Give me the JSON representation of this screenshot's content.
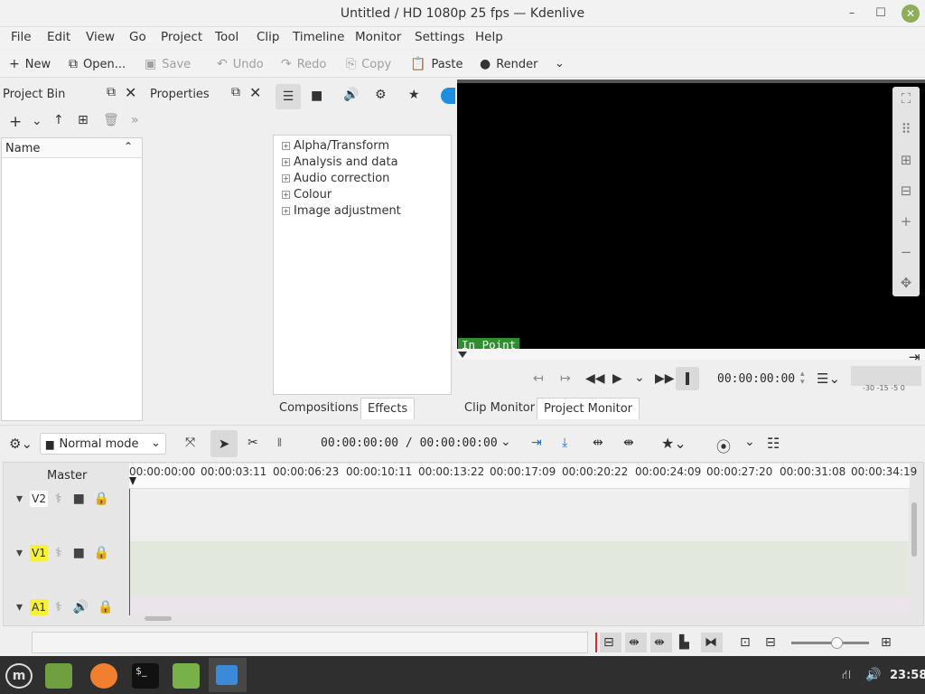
{
  "window": {
    "title": "Untitled / HD 1080p 25 fps — Kdenlive"
  },
  "menu": [
    "File",
    "Edit",
    "View",
    "Go",
    "Project",
    "Tool",
    "Clip",
    "Timeline",
    "Monitor",
    "Settings",
    "Help"
  ],
  "toolbar": {
    "new": "New",
    "open": "Open...",
    "save": "Save",
    "undo": "Undo",
    "redo": "Redo",
    "copy": "Copy",
    "paste": "Paste",
    "render": "Render"
  },
  "project_bin": {
    "title": "Project Bin",
    "column": "Name"
  },
  "properties": {
    "title": "Properties"
  },
  "effects": {
    "categories": [
      "Alpha/Transform",
      "Analysis and data",
      "Audio correction",
      "Colour",
      "Image adjustment"
    ],
    "tabs": [
      "Compositions",
      "Effects"
    ]
  },
  "monitor": {
    "in_point": "In Point",
    "timecode": "00:00:00:00",
    "vu_labels": [
      "-30",
      "-15",
      "-5",
      "0"
    ],
    "tabs": [
      "Clip Monitor",
      "Project Monitor"
    ]
  },
  "timeline": {
    "mode": "Normal mode",
    "position": "00:00:00:00 / 00:00:00:00",
    "master": "Master",
    "ruler": [
      "00:00:00:00",
      "00:00:03:11",
      "00:00:06:23",
      "00:00:10:11",
      "00:00:13:22",
      "00:00:17:09",
      "00:00:20:22",
      "00:00:24:09",
      "00:00:27:20",
      "00:00:31:08",
      "00:00:34:19"
    ],
    "tracks": [
      {
        "name": "V2",
        "color": "#ffffff"
      },
      {
        "name": "V1",
        "color": "#f5f03c"
      },
      {
        "name": "A1",
        "color": "#f5f03c"
      }
    ]
  },
  "taskbar": {
    "clock": "23:58"
  },
  "colors": {
    "accent": "#2f8f2f",
    "close": "#8fae5b"
  }
}
